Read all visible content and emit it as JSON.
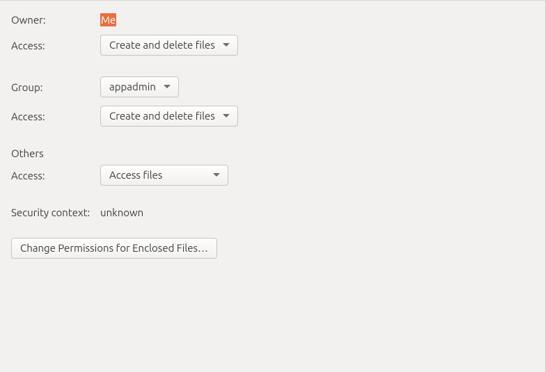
{
  "owner_section": {
    "label": "Owner:",
    "value": "Me",
    "access_label": "Access:",
    "access_value": "Create and delete files"
  },
  "group_section": {
    "label": "Group:",
    "value": "appadmin",
    "access_label": "Access:",
    "access_value": "Create and delete files"
  },
  "others_section": {
    "heading": "Others",
    "access_label": "Access:",
    "access_value": "Access files"
  },
  "security_context": {
    "label": "Security context:",
    "value": "unknown"
  },
  "change_button": "Change Permissions for Enclosed Files…"
}
